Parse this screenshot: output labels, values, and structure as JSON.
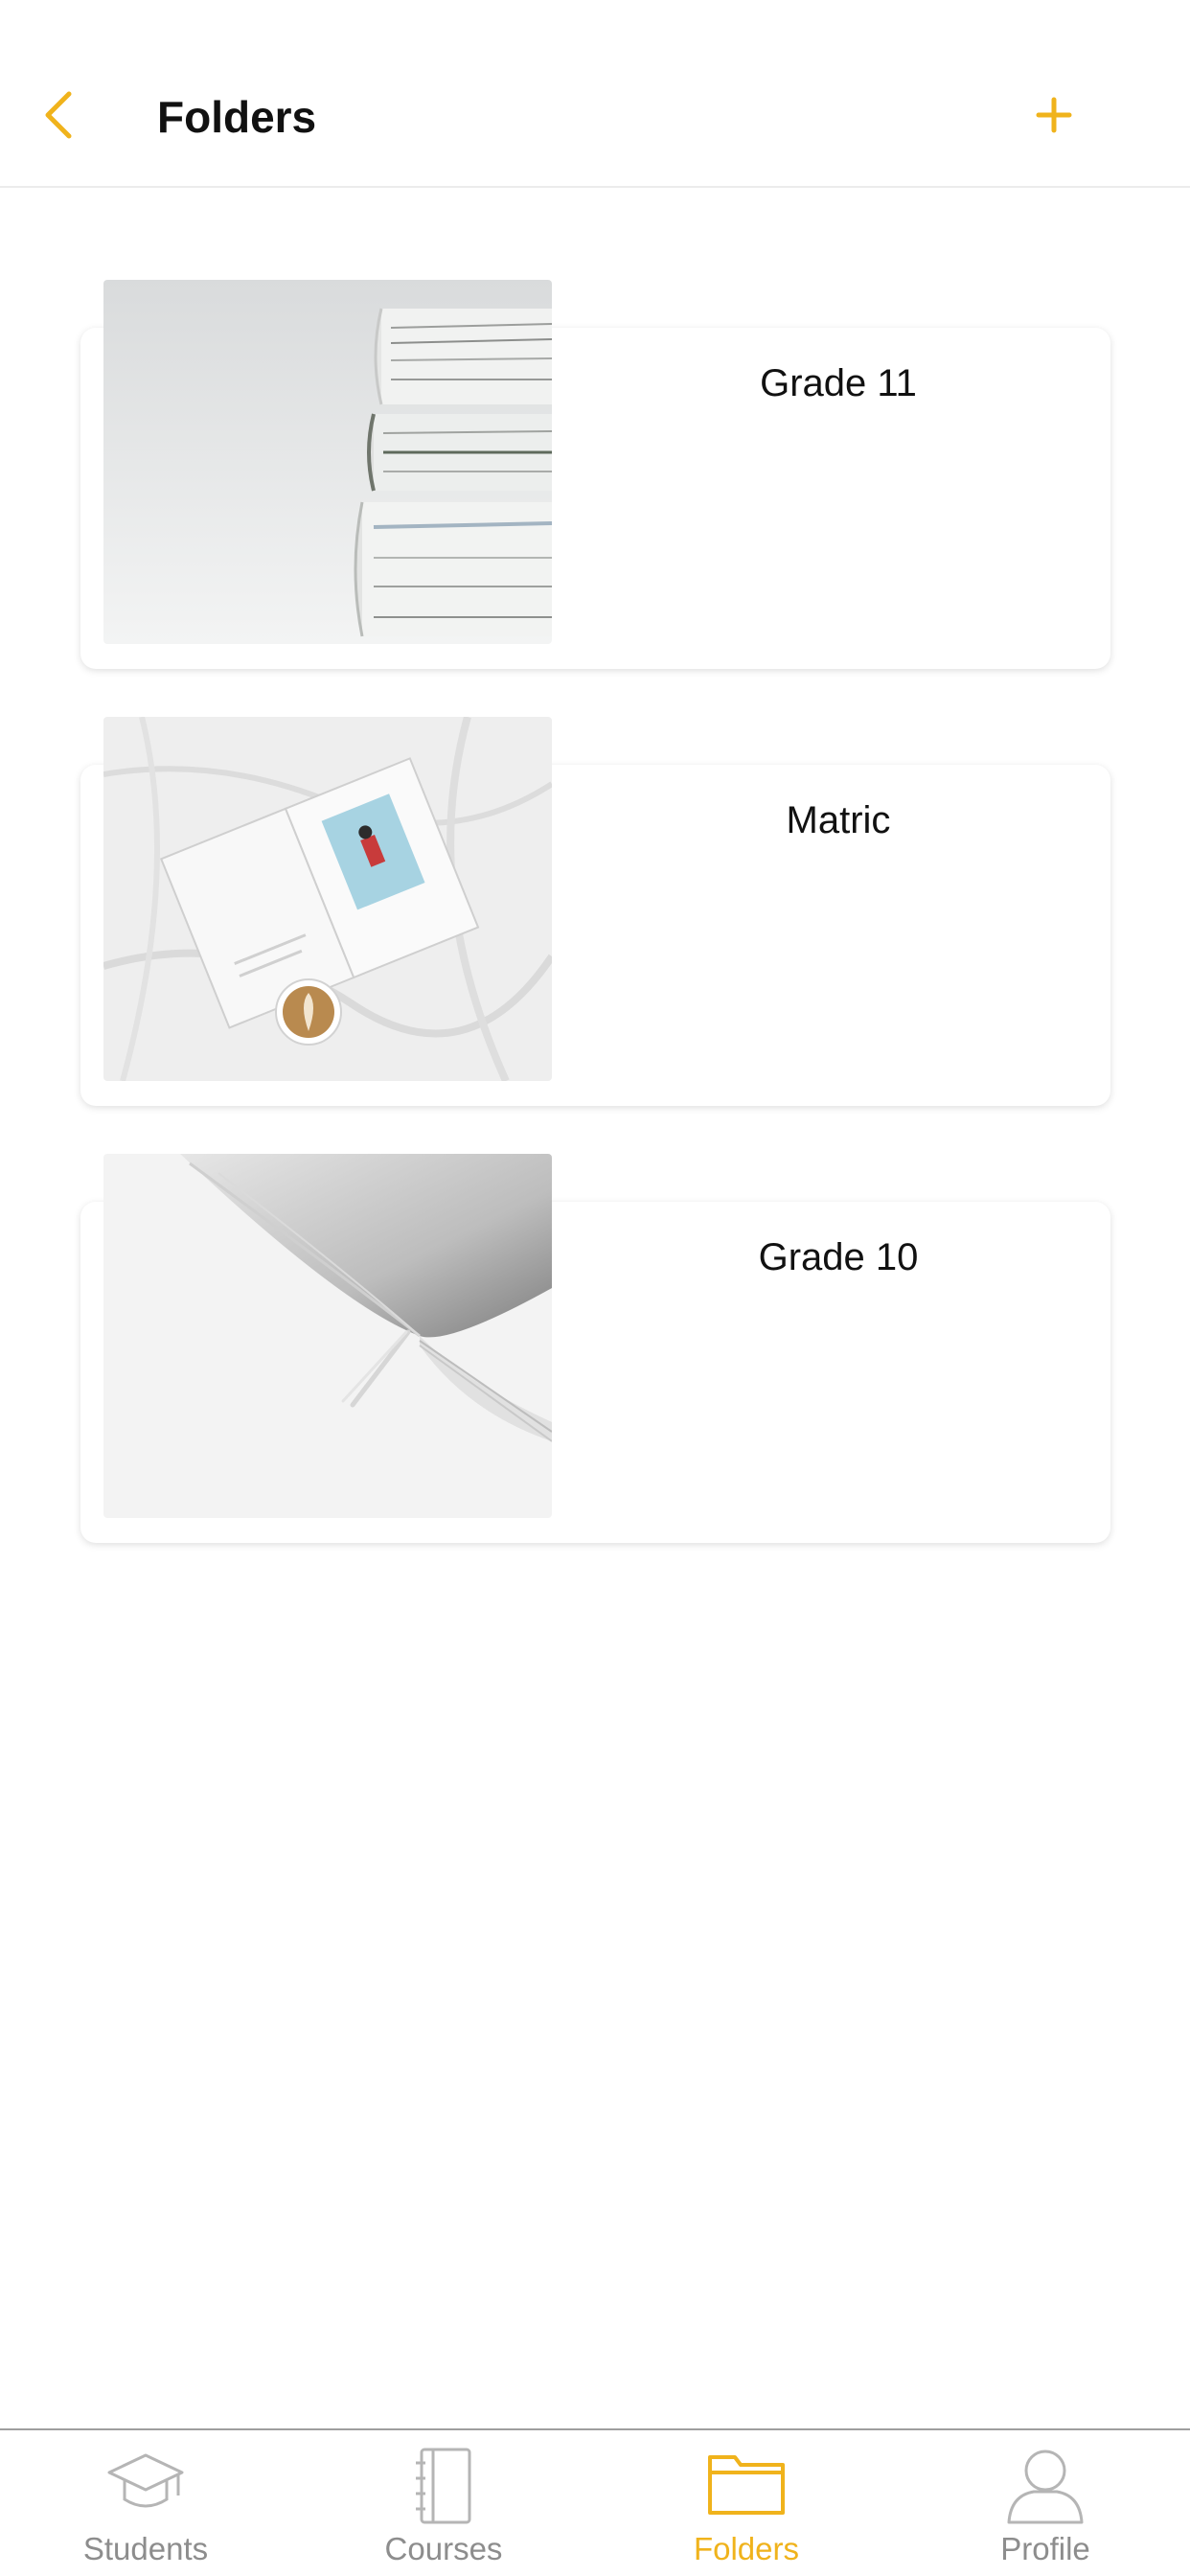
{
  "header": {
    "title": "Folders",
    "back_icon": "chevron-left-icon",
    "add_icon": "plus-icon",
    "accent": "#F0B31C"
  },
  "folders": [
    {
      "label": "Grade 11",
      "image": "stacked-binders-photo"
    },
    {
      "label": "Matric",
      "image": "open-book-and-coffee-on-sheets-photo"
    },
    {
      "label": "Grade 10",
      "image": "open-book-closeup-photo"
    }
  ],
  "tabbar": {
    "items": [
      {
        "label": "Students",
        "icon": "graduation-cap-icon",
        "active": false
      },
      {
        "label": "Courses",
        "icon": "notebook-icon",
        "active": false
      },
      {
        "label": "Folders",
        "icon": "folder-icon",
        "active": true
      },
      {
        "label": "Profile",
        "icon": "person-icon",
        "active": false
      }
    ],
    "active_color": "#F0B31C",
    "inactive_color": "#8D8D8D"
  }
}
